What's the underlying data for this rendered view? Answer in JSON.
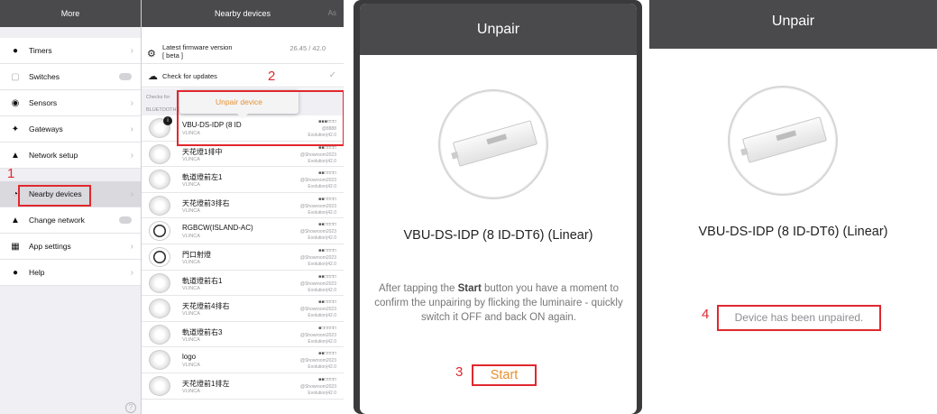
{
  "panel1": {
    "sidebar_title": "More",
    "sidebar_items": [
      {
        "label": "Timers",
        "icon": "clock-icon"
      },
      {
        "label": "Switches",
        "icon": "switch-icon"
      },
      {
        "label": "Sensors",
        "icon": "sensor-icon"
      },
      {
        "label": "Gateways",
        "icon": "gateway-icon"
      },
      {
        "label": "Network setup",
        "icon": "network-icon"
      },
      {
        "label": "Nearby devices",
        "icon": "nearby-icon"
      },
      {
        "label": "Change network",
        "icon": "network-icon"
      },
      {
        "label": "App settings",
        "icon": "app-settings-icon"
      },
      {
        "label": "Help",
        "icon": "help-icon"
      }
    ],
    "detail_title": "Nearby devices",
    "detail_action": "As",
    "firmware_label": "Latest firmware version\n[ beta ]",
    "firmware_version": "26.45 / 42.0",
    "check_updates": "Check for updates",
    "checks_for": "Checks for",
    "bluetooth_header": "BLUETOOTH DEVICES",
    "popup_unpair": "Unpair device",
    "devices": [
      {
        "name": "VBU-DS-IDP (8 ID",
        "vendor": "VLINCA",
        "signal": "■■■□□□",
        "net": "@8888",
        "fw": "Evolution|42.0"
      },
      {
        "name": "天花燈1排中",
        "vendor": "VLINCA",
        "signal": "■■□□□□",
        "net": "@Showroom2023",
        "fw": "Evolution|42.0"
      },
      {
        "name": "軌道燈前左1",
        "vendor": "VLINCA",
        "signal": "■■□□□□",
        "net": "@Showroom2023",
        "fw": "Evolution|42.0"
      },
      {
        "name": "天花燈前3排右",
        "vendor": "VLINCA",
        "signal": "■■□□□□",
        "net": "@Showroom2023",
        "fw": "Evolution|42.0"
      },
      {
        "name": "RGBCW(ISLAND-AC)",
        "vendor": "VLINCA",
        "signal": "■■□□□□",
        "net": "@Showroom2023",
        "fw": "Evolution|42.0"
      },
      {
        "name": "門口射燈",
        "vendor": "VLINCA",
        "signal": "■■□□□□",
        "net": "@Showroom2023",
        "fw": "Evolution|42.0"
      },
      {
        "name": "軌道燈前右1",
        "vendor": "VLINCA",
        "signal": "■■□□□□",
        "net": "@Showroom2023",
        "fw": "Evolution|42.0"
      },
      {
        "name": "天花燈前4排右",
        "vendor": "VLINCA",
        "signal": "■■□□□□",
        "net": "@Showroom2023",
        "fw": "Evolution|42.0"
      },
      {
        "name": "軌道燈前右3",
        "vendor": "VLINCA",
        "signal": "■□□□□□",
        "net": "@Showroom2023",
        "fw": "Evolution|42.0"
      },
      {
        "name": "logo",
        "vendor": "VLINCA",
        "signal": "■■□□□□",
        "net": "@Showroom2023",
        "fw": "Evolution|42.0"
      },
      {
        "name": "天花燈前1排左",
        "vendor": "VLINCA",
        "signal": "■■□□□□",
        "net": "@Showroom2023",
        "fw": "Evolution|42.0"
      }
    ],
    "step1": "1",
    "step2": "2"
  },
  "panel2": {
    "title": "Unpair",
    "device_name": "VBU-DS-IDP (8 ID-DT6) (Linear)",
    "instruction_before": "After tapping the ",
    "instruction_bold": "Start",
    "instruction_after": " button you have a moment to confirm the unpairing by flicking the luminaire - quickly switch it OFF and back ON again.",
    "start_button": "Start",
    "step3": "3"
  },
  "panel3": {
    "title": "Unpair",
    "device_name": "VBU-DS-IDP (8 ID-DT6) (Linear)",
    "status": "Device has been unpaired.",
    "step4": "4"
  },
  "colors": {
    "header": "#4a4a4c",
    "accent": "#e8912f",
    "annotation": "#e0282e"
  }
}
